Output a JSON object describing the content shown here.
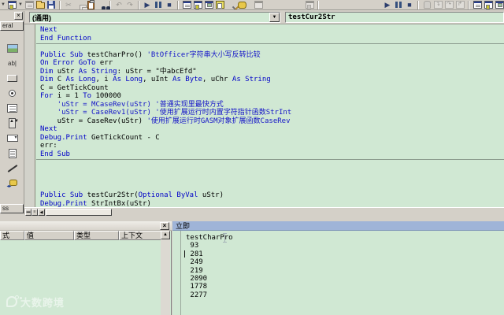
{
  "app": {
    "name": "VB6 IDE code window",
    "editor_bg": "#d0e8d3",
    "keyword_color": "#0000c8",
    "comment_color": "#1414c8",
    "chrome_color": "#d4d0c8",
    "immediate_titlebar_color": "#9fb4d8"
  },
  "toolbar": {
    "left_icons": [
      {
        "name": "toolbar-overflow-caret-icon",
        "cls": "t-caret",
        "ch": "▼"
      },
      {
        "name": "add-form-button",
        "cls": "ic-win b"
      },
      {
        "name": "add-form-caret-icon",
        "cls": "t-caret",
        "ch": "▼"
      },
      {
        "name": "menu-editor-button",
        "cls": "ic-win a",
        "grayed": true
      },
      {
        "name": "open-project-button",
        "cls": "ic-folder"
      },
      {
        "name": "save-project-button",
        "cls": "ic-floppy"
      },
      {
        "name": "cut-button",
        "ch": "✂",
        "grayed": true,
        "sep": true
      },
      {
        "name": "copy-button",
        "cls": "ic-copy",
        "grayed": true
      },
      {
        "name": "paste-button",
        "cls": "ic-paste"
      },
      {
        "name": "find-button",
        "cls": "ic-find"
      },
      {
        "name": "undo-button",
        "ch": "↶",
        "grayed": true,
        "sep": true
      },
      {
        "name": "redo-button",
        "ch": "↷",
        "grayed": true
      },
      {
        "name": "start-button",
        "ch": "▶",
        "sep": true
      },
      {
        "name": "break-button",
        "cls": "ic-pause"
      },
      {
        "name": "end-button",
        "ch": "■"
      },
      {
        "name": "project-explorer-button",
        "cls": "ic-win a",
        "sep": true
      },
      {
        "name": "properties-window-button",
        "cls": "ic-win b"
      },
      {
        "name": "form-layout-button",
        "cls": "ic-win c"
      },
      {
        "name": "object-browser-button",
        "cls": "ic-objb"
      },
      {
        "name": "toolbox-button",
        "cls": "ic-tbx"
      },
      {
        "name": "data-view-button",
        "cls": "ic-data"
      },
      {
        "name": "component-grayed-button",
        "cls": "ic-win",
        "grayed": true,
        "ml": 8
      },
      {
        "name": "alignment-grayed-button",
        "cls": "ic-win b",
        "grayed": true,
        "ml": 52
      }
    ],
    "right_icons": [
      {
        "name": "debug-start-button",
        "ch": "▶",
        "ml": 78,
        "sep": true
      },
      {
        "name": "debug-break-button",
        "cls": "ic-pause"
      },
      {
        "name": "debug-end-button",
        "ch": "■"
      },
      {
        "name": "pointer-hand-button",
        "cls": "ic-hand",
        "grayed": true,
        "sep": true
      },
      {
        "name": "step-into-button",
        "cls": "ic-step",
        "ch": "↴",
        "grayed": true
      },
      {
        "name": "step-over-button",
        "cls": "ic-step",
        "ch": "↷",
        "grayed": true
      },
      {
        "name": "step-out-button",
        "cls": "ic-step",
        "ch": "↱",
        "grayed": true
      },
      {
        "name": "locals-window-button",
        "cls": "ic-win a",
        "sep": true
      },
      {
        "name": "immediate-window-button",
        "cls": "ic-win b"
      },
      {
        "name": "watch-window-button",
        "cls": "ic-win c"
      },
      {
        "name": "quick-watch-button",
        "cls": "ic-find"
      }
    ]
  },
  "toolbox": {
    "close_glyph": "×",
    "top_tab_label": "eral",
    "bottom_tab_label": "ss",
    "items": [
      {
        "name": "picturebox-icon",
        "cls": "tb-pic"
      },
      {
        "name": "textbox-icon",
        "cls": "tb-txt",
        "ch": "ab|"
      },
      {
        "name": "commandbutton-icon",
        "cls": "tb-btn"
      },
      {
        "name": "optionbutton-icon",
        "cls": "tb-opt"
      },
      {
        "name": "listbox-icon",
        "cls": "tb-list"
      },
      {
        "name": "vscrollbar-icon",
        "cls": "tb-vsb",
        "ch": "▲▼"
      },
      {
        "name": "drivelistbox-icon",
        "cls": "tb-drv",
        "ch": "▾"
      },
      {
        "name": "filelistbox-icon",
        "cls": "tb-file"
      },
      {
        "name": "line-icon",
        "cls": "tb-line"
      },
      {
        "name": "data-control-icon",
        "cls": "tb-data"
      }
    ]
  },
  "code_window": {
    "object_dropdown": "(通用)",
    "procedure_dropdown": "testCur2Str",
    "dropdown_arrow_glyph": "▼",
    "hscroll_left_glyph": "◀",
    "lines": [
      {
        "segs": [
          [
            "Next",
            "k"
          ]
        ]
      },
      {
        "segs": [
          [
            "End Function",
            "k"
          ]
        ],
        "sep": true
      },
      {
        "segs": []
      },
      {
        "segs": [
          [
            "Public Sub ",
            "k"
          ],
          [
            "testCharPro() ",
            "n"
          ],
          [
            "'BtOfficer字符串大小写反转比较",
            "c"
          ]
        ]
      },
      {
        "segs": [
          [
            "On Error GoTo ",
            "k"
          ],
          [
            "err",
            "n"
          ]
        ]
      },
      {
        "segs": [
          [
            "Dim ",
            "k"
          ],
          [
            "uStr ",
            "n"
          ],
          [
            "As String",
            "k"
          ],
          [
            ": uStr = \"中abcEfd\"",
            "n"
          ]
        ]
      },
      {
        "segs": [
          [
            "Dim ",
            "k"
          ],
          [
            "C ",
            "n"
          ],
          [
            "As Long",
            "k"
          ],
          [
            ", i ",
            "n"
          ],
          [
            "As Long",
            "k"
          ],
          [
            ", uInt ",
            "n"
          ],
          [
            "As Byte",
            "k"
          ],
          [
            ", uChr ",
            "n"
          ],
          [
            "As String",
            "k"
          ]
        ]
      },
      {
        "segs": [
          [
            "C = GetTickCount",
            "n"
          ]
        ]
      },
      {
        "segs": [
          [
            "For ",
            "k"
          ],
          [
            "i = 1 ",
            "n"
          ],
          [
            "To ",
            "k"
          ],
          [
            "100000",
            "n"
          ]
        ]
      },
      {
        "segs": [
          [
            "    'uStr = MCaseRev(uStr) '普通实现里最快方式",
            "c"
          ]
        ]
      },
      {
        "segs": [
          [
            "    'uStr = CaseRev1(uStr) '使用扩展运行时内置字符指针函数StrInt",
            "c"
          ]
        ]
      },
      {
        "segs": [
          [
            "    uStr = CaseRev(uStr) ",
            "n"
          ],
          [
            "'使用扩展运行时GASM对象扩展函数CaseRev",
            "c"
          ]
        ]
      },
      {
        "segs": [
          [
            "Next",
            "k"
          ]
        ]
      },
      {
        "segs": [
          [
            "Debug.Print ",
            "k"
          ],
          [
            "GetTickCount - C",
            "n"
          ]
        ]
      },
      {
        "segs": [
          [
            "err:",
            "n"
          ]
        ]
      },
      {
        "segs": [
          [
            "End Sub",
            "k"
          ]
        ],
        "sep": true
      },
      {
        "segs": []
      },
      {
        "segs": []
      },
      {
        "segs": []
      },
      {
        "segs": []
      },
      {
        "segs": [
          [
            "Public Sub ",
            "k"
          ],
          [
            "testCur2Str(",
            "n"
          ],
          [
            "Optional ByVal ",
            "k"
          ],
          [
            "uStr)",
            "n"
          ]
        ]
      },
      {
        "segs": [
          [
            "Debug.Print ",
            "k"
          ],
          [
            "StrIntBx(uStr)",
            "n"
          ]
        ]
      }
    ]
  },
  "watch": {
    "close_glyph": "×",
    "scroll_up_glyph": "▲",
    "columns": [
      "式",
      "值",
      "类型",
      "上下文"
    ]
  },
  "immediate": {
    "title": "立即",
    "lines": [
      "testCharPro",
      " 93",
      " 281",
      " 249",
      " 219",
      " 2090",
      " 1778",
      " 2277"
    ],
    "caret_line": 2
  },
  "watermark": {
    "text": "大数跨境"
  }
}
